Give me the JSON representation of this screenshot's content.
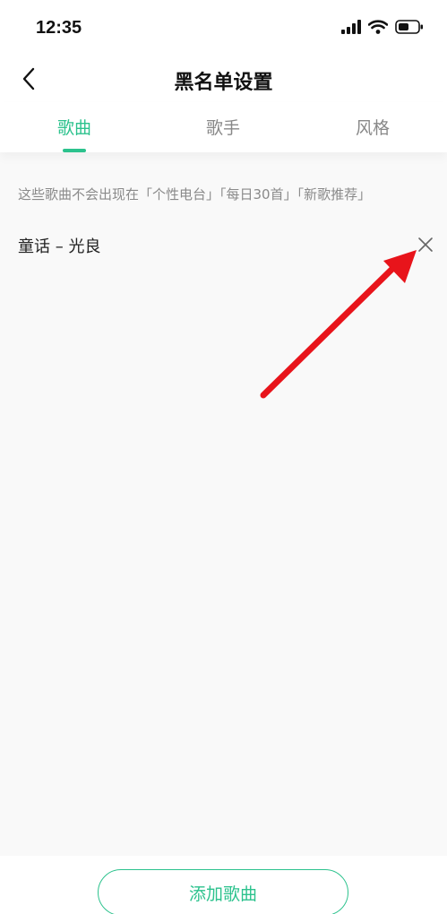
{
  "status_bar": {
    "time": "12:35"
  },
  "header": {
    "title": "黑名单设置",
    "back_icon": "chevron-left-icon"
  },
  "tabs": [
    {
      "label": "歌曲",
      "active": true
    },
    {
      "label": "歌手",
      "active": false
    },
    {
      "label": "风格",
      "active": false
    }
  ],
  "hint": "这些歌曲不会出现在「个性电台」「每日30首」「新歌推荐」",
  "songs": [
    {
      "title": "童话 – 光良",
      "remove_icon": "close-icon"
    }
  ],
  "footer": {
    "add_button_label": "添加歌曲"
  },
  "colors": {
    "accent": "#2cc28d",
    "annotation": "#e8141b",
    "background": "#f9f9f9"
  }
}
